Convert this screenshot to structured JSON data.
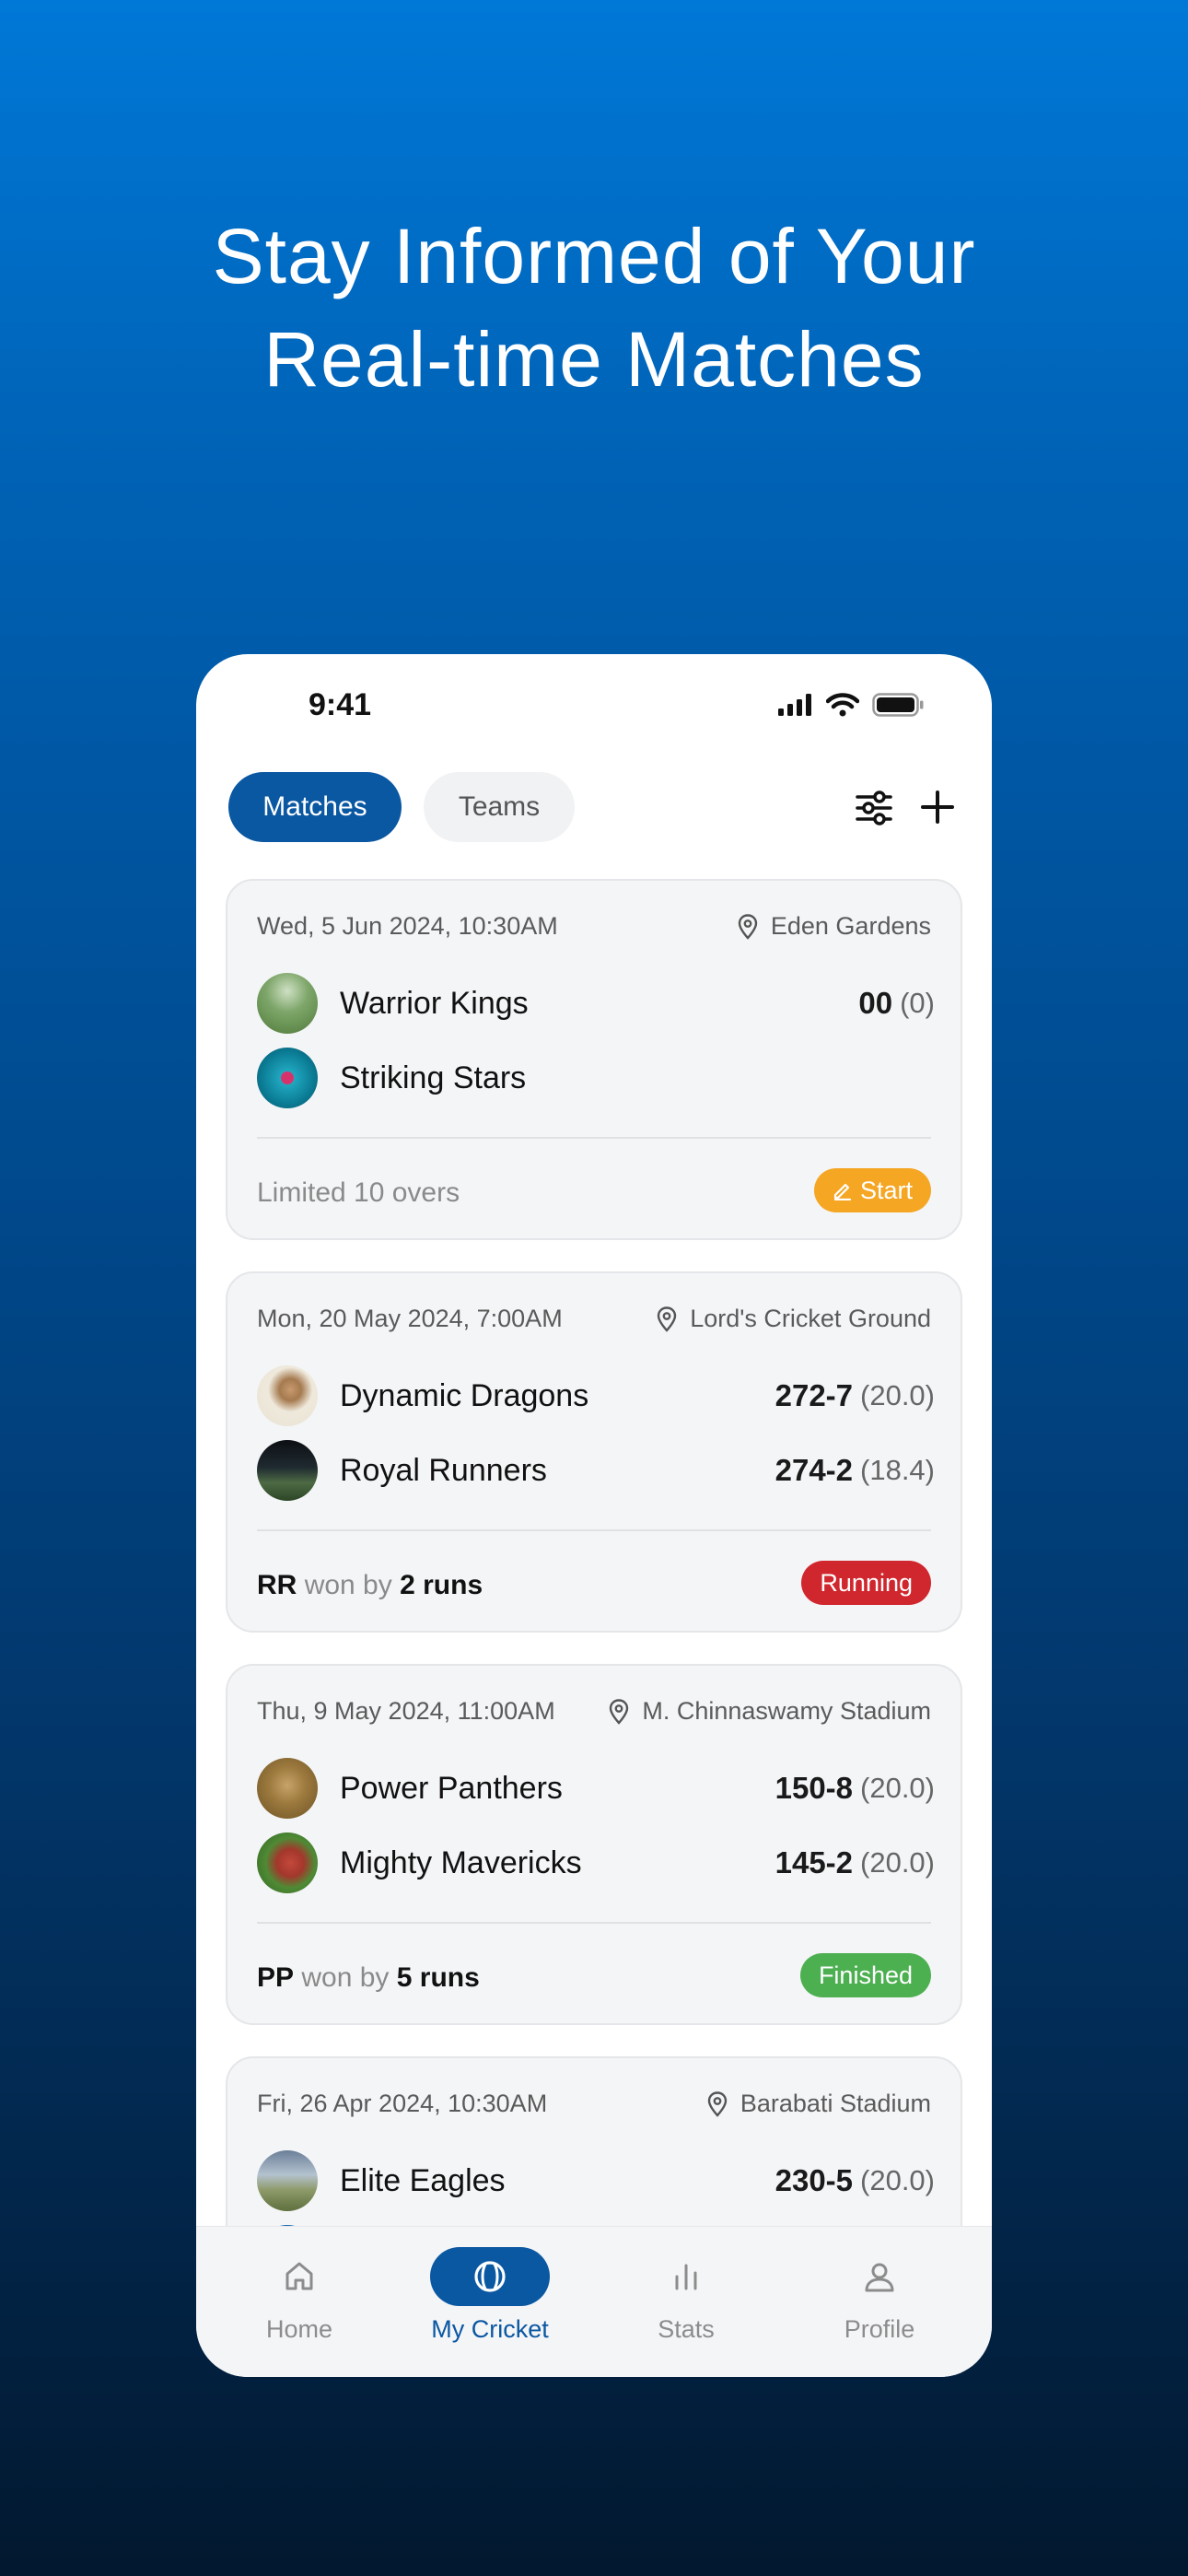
{
  "headline": {
    "line1": "Stay Informed of Your",
    "line2": "Real-time Matches"
  },
  "status_bar": {
    "time": "9:41"
  },
  "tabs": [
    {
      "label": "Matches",
      "active": true
    },
    {
      "label": "Teams",
      "active": false
    }
  ],
  "matches": [
    {
      "date": "Wed, 5 Jun 2024, 10:30AM",
      "venue": "Eden Gardens",
      "team_a": {
        "name": "Warrior Kings",
        "score": "00",
        "overs": "(0)"
      },
      "team_b": {
        "name": "Striking Stars",
        "score": "",
        "overs": ""
      },
      "foot": {
        "abbr": "",
        "text": "Limited 10 overs",
        "margin": ""
      },
      "badge": {
        "label": "Start",
        "color": "#f5a623"
      }
    },
    {
      "date": "Mon, 20 May 2024, 7:00AM",
      "venue": "Lord's Cricket Ground",
      "team_a": {
        "name": "Dynamic Dragons",
        "score": "272-7",
        "overs": "(20.0)"
      },
      "team_b": {
        "name": "Royal Runners",
        "score": "274-2",
        "overs": "(18.4)"
      },
      "foot": {
        "abbr": "RR",
        "text": "won by",
        "margin": "2 runs"
      },
      "badge": {
        "label": "Running",
        "color": "#d0262d"
      }
    },
    {
      "date": "Thu, 9 May 2024, 11:00AM",
      "venue": "M. Chinnaswamy Stadium",
      "team_a": {
        "name": "Power Panthers",
        "score": "150-8",
        "overs": "(20.0)"
      },
      "team_b": {
        "name": "Mighty Mavericks",
        "score": "145-2",
        "overs": "(20.0)"
      },
      "foot": {
        "abbr": "PP",
        "text": "won by",
        "margin": "5 runs"
      },
      "badge": {
        "label": "Finished",
        "color": "#4caf50"
      }
    },
    {
      "date": "Fri, 26 Apr 2024, 10:30AM",
      "venue": "Barabati Stadium",
      "team_a": {
        "name": "Elite Eagles",
        "score": "230-5",
        "overs": "(20.0)"
      }
    }
  ],
  "nav": [
    {
      "label": "Home",
      "icon": "home-icon",
      "active": false
    },
    {
      "label": "My Cricket",
      "icon": "cricket-ball-icon",
      "active": true
    },
    {
      "label": "Stats",
      "icon": "bar-chart-icon",
      "active": false
    },
    {
      "label": "Profile",
      "icon": "user-icon",
      "active": false
    }
  ],
  "colors": {
    "accent": "#0a57a2",
    "start": "#f5a623",
    "running": "#d0262d",
    "finished": "#4caf50"
  }
}
